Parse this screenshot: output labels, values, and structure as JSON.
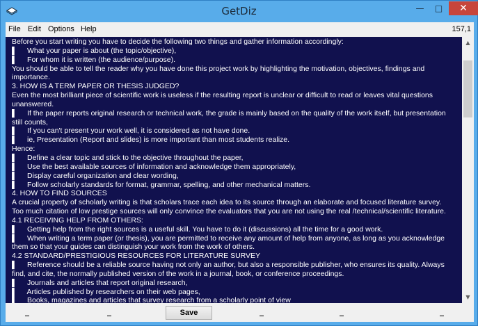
{
  "window": {
    "title": "GetDiz",
    "close_glyph": "✕",
    "minimize_glyph": "—",
    "maximize_glyph": "□"
  },
  "menu": {
    "items": [
      "File",
      "Edit",
      "Options",
      "Help"
    ],
    "position_indicator": "157,1"
  },
  "document": {
    "lines": [
      "Before you start writing you have to decide the following two things and gather information accordingly:",
      "▌     What your paper is about (the topic/objective),",
      "▌     For whom it is written (the audience/purpose).",
      "You should be able to tell the reader why you have done this project work by highlighting the motivation, objectives, findings and",
      "importance.",
      "3. HOW IS A TERM PAPER OR THESIS JUDGED?",
      "Even the most brilliant piece of scientific work is useless if the resulting report is unclear or difficult to read or leaves vital questions",
      "unanswered.",
      "▌     If the paper reports original research or technical work, the grade is mainly based on the quality of the work itself, but presentation",
      "still counts,",
      "▌     If you can't present your work well, it is considered as not have done.",
      "▌     ie, Presentation (Report and slides) is more important than most students realize.",
      "Hence:",
      "▌     Define a clear topic and stick to the objective throughout the paper,",
      "▌     Use the best available sources of information and acknowledge them appropriately,",
      "▌     Display careful organization and clear wording,",
      "▌     Follow scholarly standards for format, grammar, spelling, and other mechanical matters.",
      "4. HOW TO FIND SOURCES",
      "A crucial property of scholarly writing is that scholars trace each idea to its source through an elaborate and focused literature survey.",
      "Too much citation of low prestige sources will only convince the evaluators that you are not using the real /technical/scientific literature.",
      "4.1 RECEIVING HELP FROM OTHERS:",
      "▌     Getting help from the right sources is a useful skill. You have to do it (discussions) all the time for a good work.",
      "▌     When writing a term paper (or thesis), you are permitted to receive any amount of help from anyone, as long as you acknowledge",
      "them so that your guides can distinguish your work from the work of others.",
      "4.2 STANDARD/PRESTIGIOUS RESOURCES FOR LITERATURE SURVEY",
      "▌     Reference should be a reliable source having not only an author, but also a responsible publisher, who ensures its quality. Always",
      "find, and cite, the normally published version of the work in a journal, book, or conference proceedings.",
      "▌     Journals and articles that report original research,",
      "▌     Articles published by researchers on their web pages,",
      "▌     Books, magazines and articles that survey research from a scholarly point of view"
    ]
  },
  "scrollbar": {
    "up_glyph": "▲",
    "down_glyph": "▼"
  },
  "statusbar": {
    "save_label": "Save"
  }
}
